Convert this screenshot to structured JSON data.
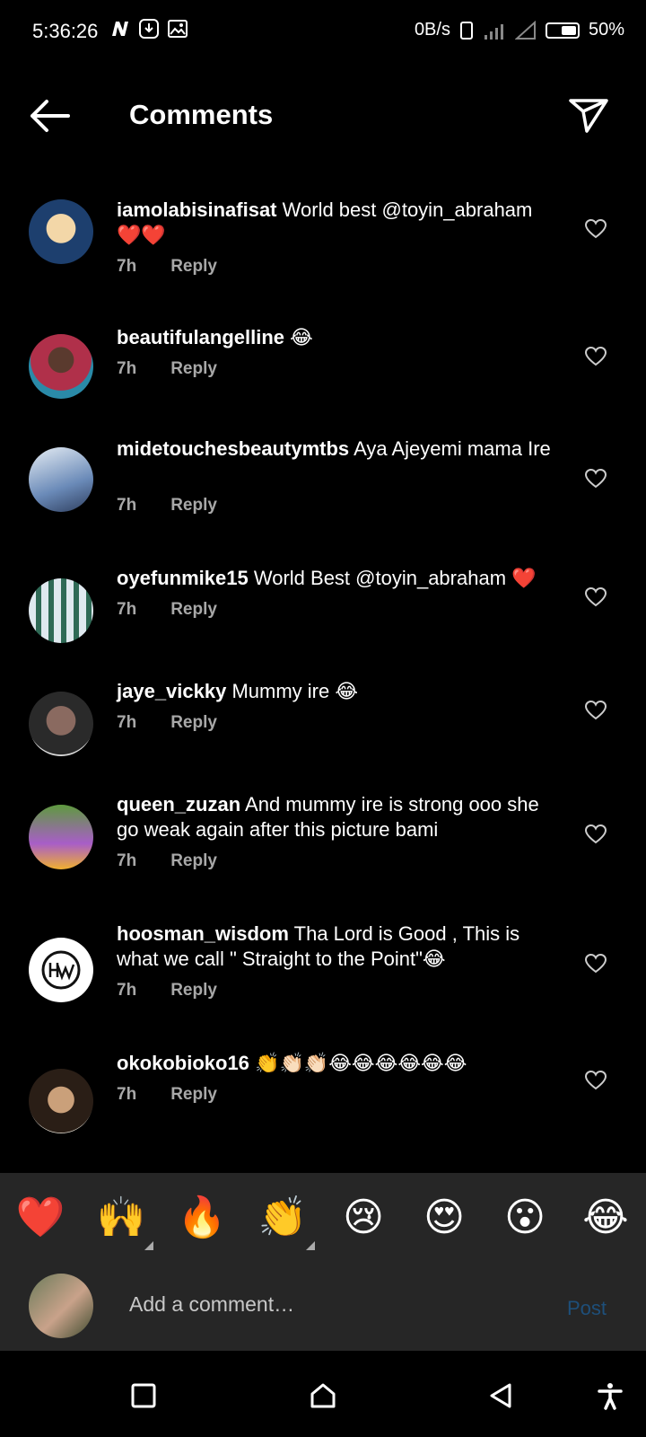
{
  "status_bar": {
    "time": "5:36:26",
    "net_speed": "0B/s",
    "battery": "50%"
  },
  "header": {
    "title": "Comments"
  },
  "comments": [
    {
      "username": "iamolabisinafisat",
      "text": "World best @toyin_abraham ❤️❤️",
      "time": "7h",
      "reply": "Reply",
      "avatar_color": "#2a4a7a"
    },
    {
      "username": "beautifulangelline",
      "text": "😂",
      "time": "7h",
      "reply": "Reply",
      "avatar_color": "#a8324a"
    },
    {
      "username": "midetouchesbeautymtbs",
      "text": "Aya Ajeyemi mama Ire",
      "time": "7h",
      "reply": "Reply",
      "avatar_color": "#c9d6e3"
    },
    {
      "username": "oyefunmike15",
      "text": "World Best @toyin_abraham ❤️",
      "time": "7h",
      "reply": "Reply",
      "avatar_color": "#3a6b5a"
    },
    {
      "username": "jaye_vickky",
      "text": "Mummy ire 😂",
      "time": "7h",
      "reply": "Reply",
      "avatar_color": "#7a6a66"
    },
    {
      "username": "queen_zuzan",
      "text": "And mummy ire is strong ooo she go weak again after this picture bami",
      "time": "7h",
      "reply": "Reply",
      "avatar_color": "#4a7a3a"
    },
    {
      "username": "hoosman_wisdom",
      "text": "Tha Lord is Good , This is what we call \" Straight to the Point\"😂",
      "time": "7h",
      "reply": "Reply",
      "avatar_color": "#ffffff"
    },
    {
      "username": "okokobioko16",
      "text": "👏👏🏻👏🏻😂😂😂😂😂😂",
      "time": "7h",
      "reply": "Reply",
      "avatar_color": "#e8e2d8"
    }
  ],
  "emoji_bar": [
    "❤️",
    "🙌",
    "🔥",
    "👏",
    "😢",
    "😍",
    "😮",
    "😂"
  ],
  "composer": {
    "placeholder": "Add a comment…",
    "post_label": "Post"
  }
}
